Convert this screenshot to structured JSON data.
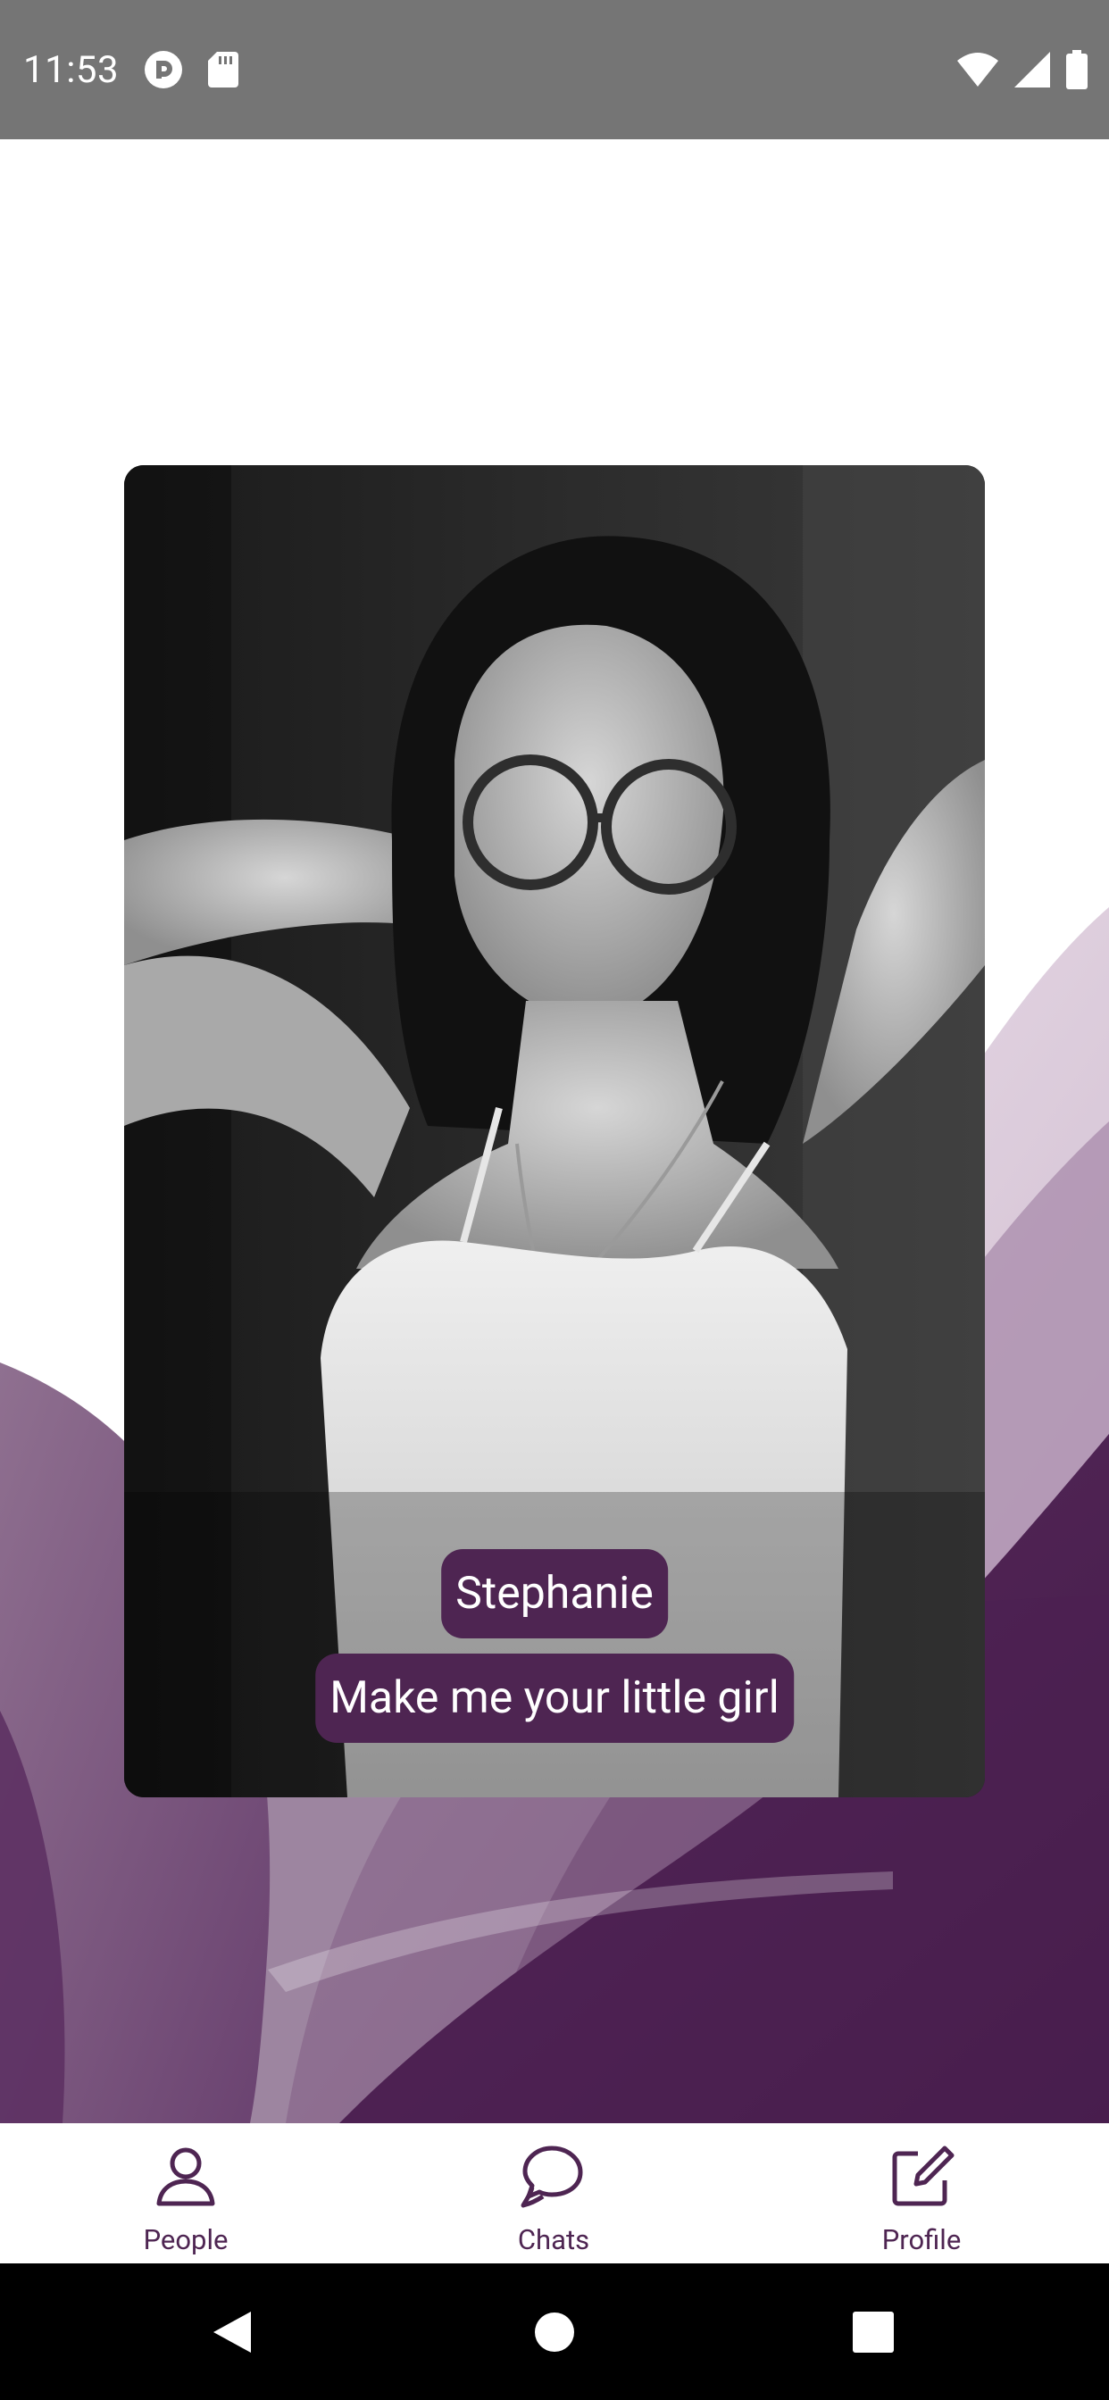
{
  "status_bar": {
    "time": "11:53",
    "icons": [
      "pocket-casts-icon",
      "sd-card-icon",
      "wifi-icon",
      "cell-signal-icon",
      "battery-icon"
    ]
  },
  "profile": {
    "name": "Stephanie",
    "tagline": "Make me your little girl"
  },
  "bottom_nav": {
    "items": [
      {
        "label": "People",
        "icon": "person-icon",
        "selected": true
      },
      {
        "label": "Chats",
        "icon": "chat-bubbles-icon",
        "selected": false
      },
      {
        "label": "Profile",
        "icon": "edit-square-icon",
        "selected": false
      }
    ]
  },
  "system_nav": {
    "buttons": [
      "back-icon",
      "home-icon",
      "recents-icon"
    ]
  },
  "colors": {
    "accent": "#4e2552",
    "status_bar": "#757575",
    "system_nav": "#000000",
    "background": "#ffffff"
  }
}
